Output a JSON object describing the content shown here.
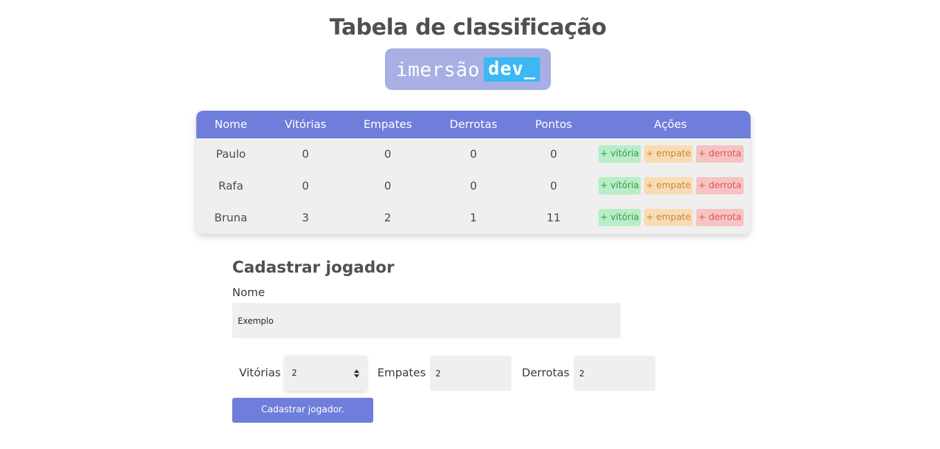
{
  "header": {
    "title": "Tabela de classificação",
    "logo_word": "imersão",
    "logo_highlight": "dev_"
  },
  "table": {
    "columns": [
      "Nome",
      "Vitórias",
      "Empates",
      "Derrotas",
      "Pontos",
      "Ações"
    ],
    "rows": [
      {
        "nome": "Paulo",
        "vitorias": "0",
        "empates": "0",
        "derrotas": "0",
        "pontos": "0"
      },
      {
        "nome": "Rafa",
        "vitorias": "0",
        "empates": "0",
        "derrotas": "0",
        "pontos": "0"
      },
      {
        "nome": "Bruna",
        "vitorias": "3",
        "empates": "2",
        "derrotas": "1",
        "pontos": "11"
      }
    ],
    "actions": {
      "win": "+ vitória",
      "draw": "+ empate",
      "loss": "+ derrota"
    }
  },
  "form": {
    "title": "Cadastrar jogador",
    "name_label": "Nome",
    "name_value": "Exemplo",
    "wins_label": "Vitórias",
    "wins_value": "2",
    "draws_label": "Empates",
    "draws_value": "2",
    "losses_label": "Derrotas",
    "losses_value": "2",
    "submit_label": "Cadastrar jogador."
  },
  "colors": {
    "accent": "#6f7ddb",
    "logo_bg": "#a7afe3",
    "logo_highlight_bg": "#3cb8f5",
    "win_bg": "#b9edc7",
    "draw_bg": "#f9dcb4",
    "loss_bg": "#f6c3c3"
  }
}
